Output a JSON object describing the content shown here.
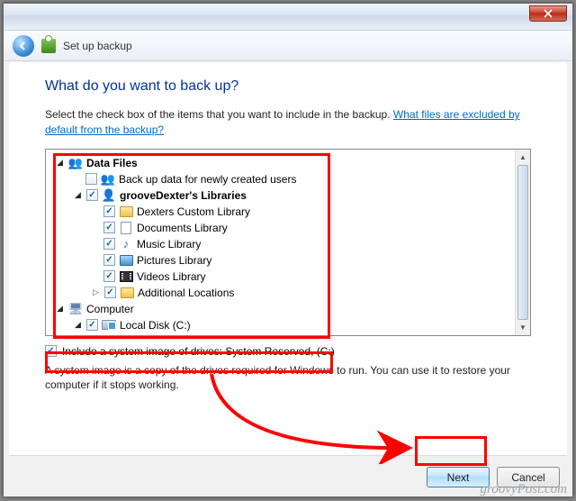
{
  "window": {
    "title": "Set up backup"
  },
  "page": {
    "heading": "What do you want to back up?",
    "description": "Select the check box of the items that you want to include in the backup.",
    "help_link": "What files are excluded by default from the backup?"
  },
  "tree": {
    "data_files": {
      "label": "Data Files",
      "newly_created": "Back up data for newly created users",
      "user_libraries": "grooveDexter's Libraries",
      "libs": {
        "custom": "Dexters Custom Library",
        "documents": "Documents Library",
        "music": "Music Library",
        "pictures": "Pictures Library",
        "videos": "Videos Library",
        "additional": "Additional Locations"
      }
    },
    "computer": {
      "label": "Computer",
      "local_disk": "Local Disk (C:)"
    }
  },
  "system_image": {
    "checkbox_label": "Include a system image of drives: System Reserved, (C:)",
    "description": "A system image is a copy of the drives required for Windows to run. You can use it to restore your computer if it stops working."
  },
  "buttons": {
    "next": "Next",
    "cancel": "Cancel"
  },
  "watermark": "groovyPost.com"
}
